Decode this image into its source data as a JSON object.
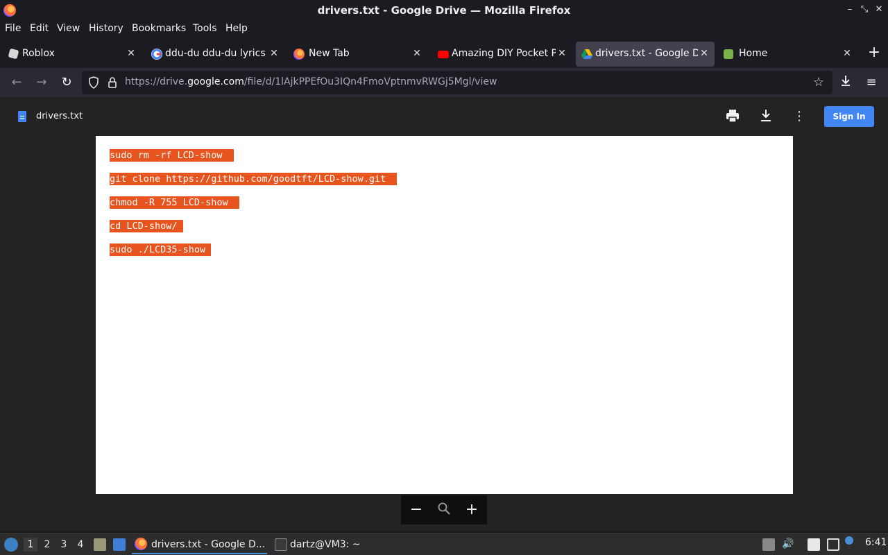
{
  "window": {
    "title": "drivers.txt - Google Drive — Mozilla Firefox",
    "controls": [
      "–",
      "⤡",
      "✕"
    ]
  },
  "menu": [
    "File",
    "Edit",
    "View",
    "History",
    "Bookmarks",
    "Tools",
    "Help"
  ],
  "tabs": [
    {
      "label": "Roblox",
      "icon": "roblox-icon",
      "active": false
    },
    {
      "label": "ddu-du ddu-du lyrics -",
      "icon": "google-icon",
      "active": false
    },
    {
      "label": "New Tab",
      "icon": "firefox-icon",
      "active": false
    },
    {
      "label": "Amazing DIY Pocket PC",
      "icon": "youtube-icon",
      "active": false
    },
    {
      "label": "drivers.txt - Google Dr",
      "icon": "google-drive-icon",
      "active": true
    },
    {
      "label": "Home",
      "icon": "home-icon",
      "active": false
    }
  ],
  "newtab": "+",
  "nav": {
    "url_prefix": "https://drive.",
    "url_domain": "google.com",
    "url_suffix": "/file/d/1lAjkPPEfOu3IQn4FmoVptnmvRWGj5Mgl/view"
  },
  "viewer": {
    "filename": "drivers.txt",
    "signin": "Sign In",
    "lines": [
      "sudo rm -rf LCD-show ",
      "git clone https://github.com/goodtft/LCD-show.git ",
      "chmod -R 755 LCD-show ",
      "cd LCD-show/",
      "sudo ./LCD35-show"
    ],
    "zoom_out": "−",
    "zoom_in": "+"
  },
  "taskbar": {
    "workspaces": [
      "1",
      "2",
      "3",
      "4"
    ],
    "active_workspace": "1",
    "tasks": [
      {
        "label": "drivers.txt - Google D...",
        "icon": "firefox-icon",
        "active": true
      },
      {
        "label": "dartz@VM3: ~",
        "icon": "terminal-icon",
        "active": false
      }
    ],
    "clock": "6:41"
  },
  "colors": {
    "highlight": "#e8541e",
    "signin": "#4285f4",
    "active_tab": "#42414d"
  }
}
